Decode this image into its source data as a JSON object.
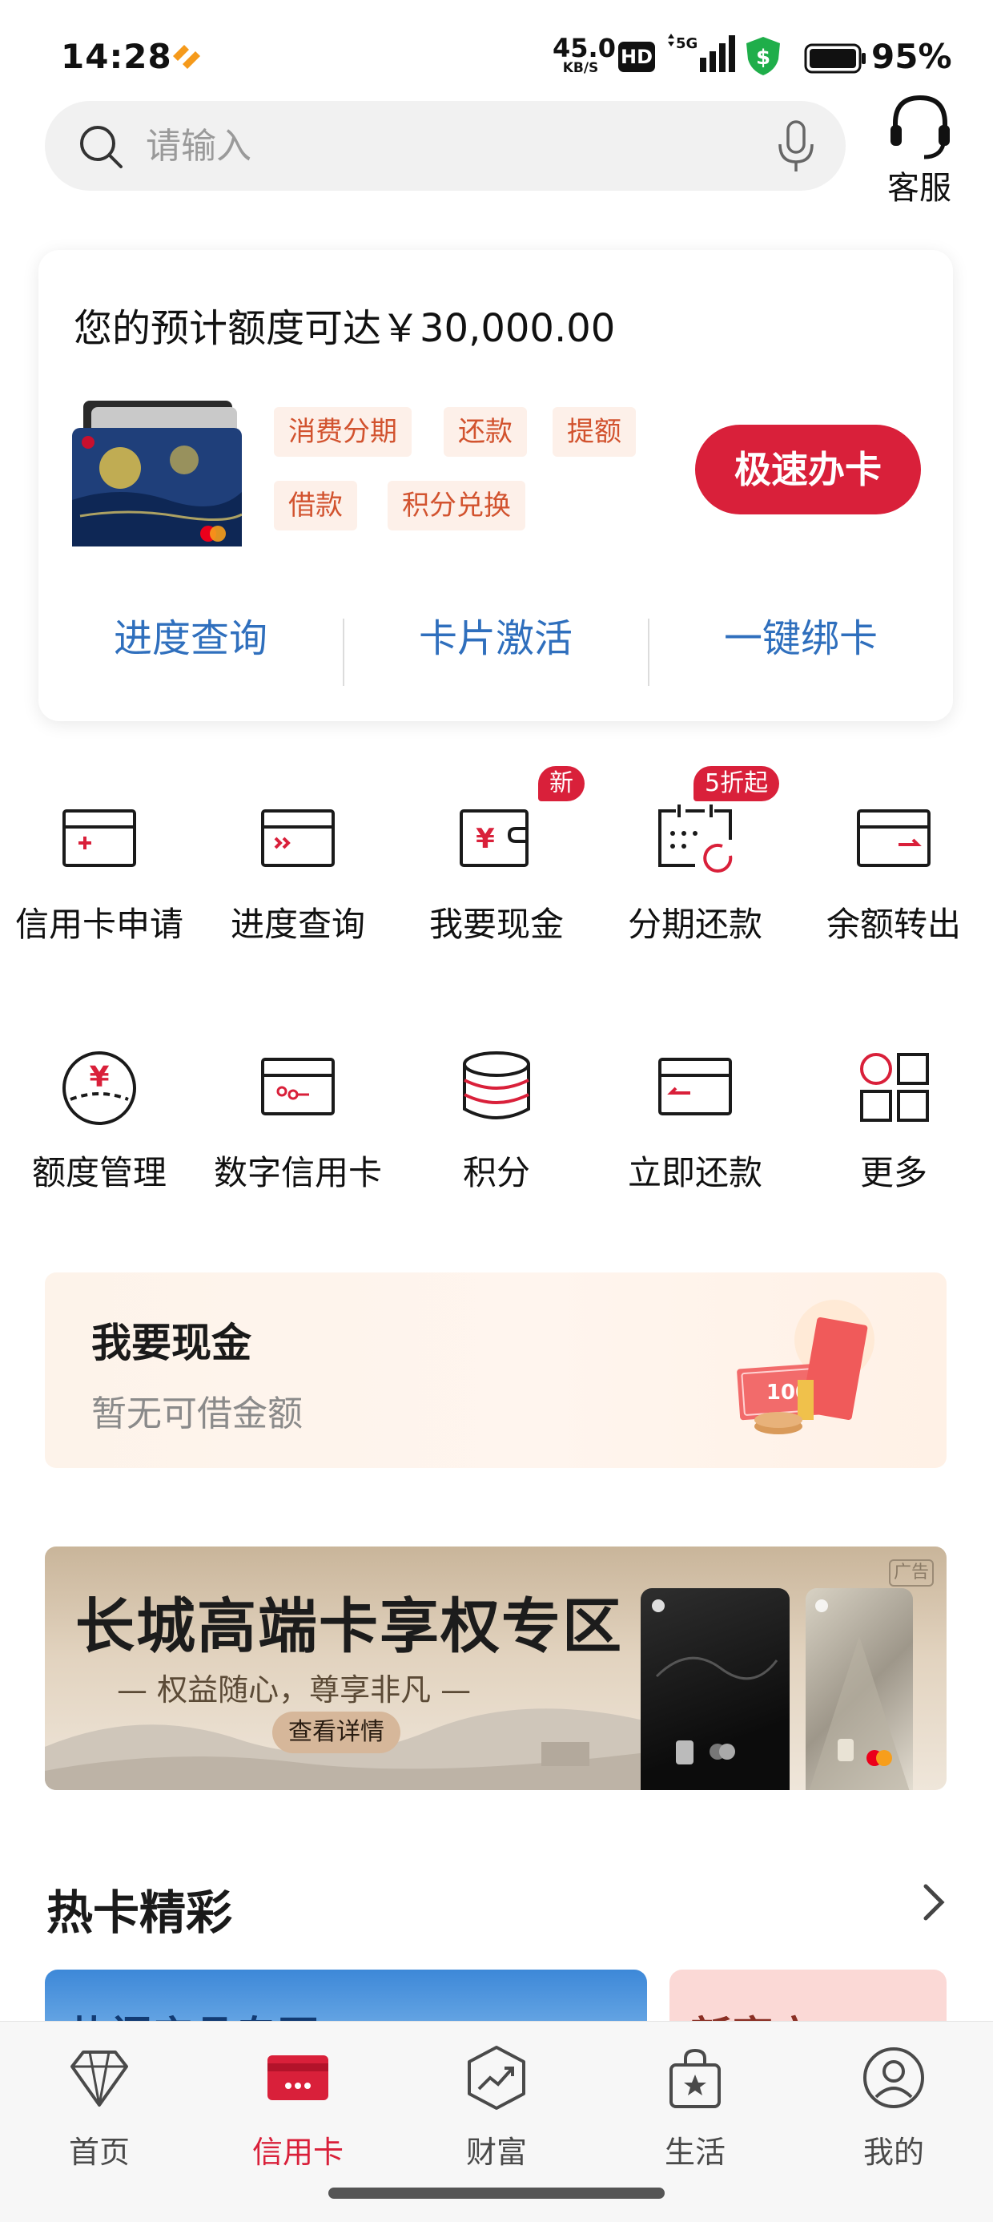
{
  "status_bar": {
    "time": "14:28",
    "net_speed_value": "45.0",
    "net_speed_unit": "KB/S",
    "hd": "HD",
    "network": "5G",
    "battery": "95%"
  },
  "search": {
    "placeholder": "请输入",
    "service_label": "客服"
  },
  "card_panel": {
    "quota_text": "您的预计额度可达",
    "quota_amount": "￥30,000.00",
    "tags": [
      "消费分期",
      "还款",
      "提额",
      "借款",
      "积分兑换"
    ],
    "apply_button": "极速办卡",
    "links": [
      "进度查询",
      "卡片激活",
      "一键绑卡"
    ]
  },
  "services": [
    {
      "label": "信用卡申请",
      "icon": "card-plus-icon",
      "badge": null
    },
    {
      "label": "进度查询",
      "icon": "card-progress-icon",
      "badge": null
    },
    {
      "label": "我要现金",
      "icon": "wallet-yuan-icon",
      "badge": "新"
    },
    {
      "label": "分期还款",
      "icon": "calendar-installment-icon",
      "badge": "5折起"
    },
    {
      "label": "余额转出",
      "icon": "card-transfer-out-icon",
      "badge": null
    },
    {
      "label": "额度管理",
      "icon": "yuan-circle-icon",
      "badge": null
    },
    {
      "label": "数字信用卡",
      "icon": "digital-card-icon",
      "badge": null
    },
    {
      "label": "积分",
      "icon": "coins-stack-icon",
      "badge": null
    },
    {
      "label": "立即还款",
      "icon": "card-repay-icon",
      "badge": null
    },
    {
      "label": "更多",
      "icon": "grid-more-icon",
      "badge": null
    }
  ],
  "cash_banner": {
    "title": "我要现金",
    "subtitle": "暂无可借金额",
    "bill_value": "100"
  },
  "ad_banner": {
    "title": "长城高端卡享权专区",
    "subtitle": "— 权益随心，尊享非凡 —",
    "button": "查看详情",
    "tag": "广告"
  },
  "hot_cards": {
    "title": "热卡精彩",
    "items": [
      "热门产品专区",
      "新客户"
    ]
  },
  "tabbar": {
    "items": [
      {
        "label": "首页",
        "icon": "diamond-icon"
      },
      {
        "label": "信用卡",
        "icon": "credit-card-icon"
      },
      {
        "label": "财富",
        "icon": "wealth-chart-icon"
      },
      {
        "label": "生活",
        "icon": "shopping-bag-icon"
      },
      {
        "label": "我的",
        "icon": "profile-icon"
      }
    ],
    "active_index": 1
  },
  "colors": {
    "brand_red": "#d9203a",
    "link_blue": "#2f6fbd",
    "tag_text": "#d2532f",
    "tag_bg": "#fdf0e9"
  }
}
